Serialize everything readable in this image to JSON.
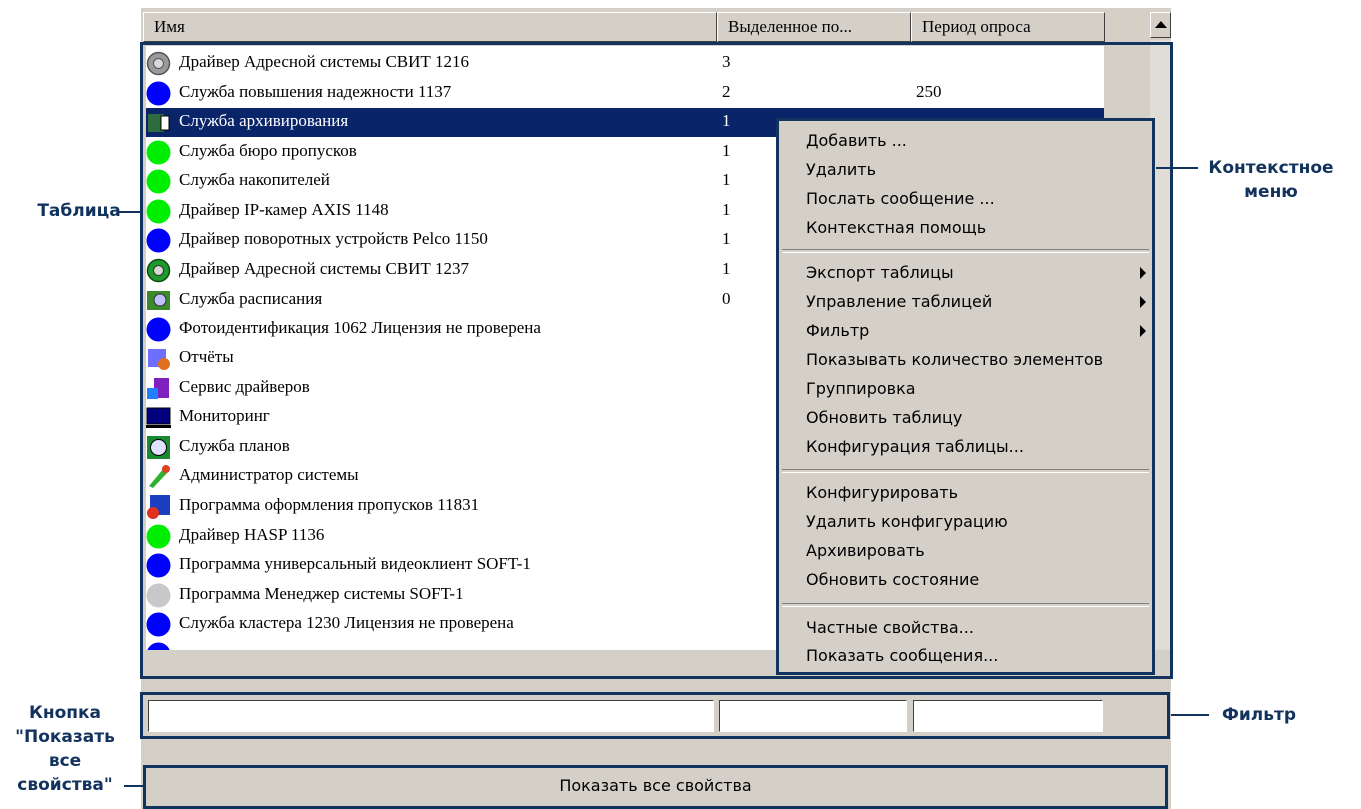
{
  "columns": [
    "Имя",
    "Выделенное по...",
    "Период опроса"
  ],
  "rows": [
    {
      "name": "Драйвер Адресной системы СВИТ 1216",
      "alloc": "3",
      "period": "",
      "icon": "gear-gray-icon"
    },
    {
      "name": "Служба повышения надежности 1137",
      "alloc": "2",
      "period": "250",
      "icon": "status-blue-icon"
    },
    {
      "name": "Служба архивирования",
      "alloc": "1",
      "period": "",
      "icon": "archive-icon"
    },
    {
      "name": "Служба бюро пропусков",
      "alloc": "1",
      "period": "",
      "icon": "status-green-icon"
    },
    {
      "name": "Служба накопителей",
      "alloc": "1",
      "period": "",
      "icon": "status-green-icon"
    },
    {
      "name": "Драйвер IP-камер AXIS 1148",
      "alloc": "1",
      "period": "",
      "icon": "status-green-icon"
    },
    {
      "name": "Драйвер поворотных устройств Pelco 1150",
      "alloc": "1",
      "period": "",
      "icon": "status-blue-icon"
    },
    {
      "name": "Драйвер Адресной системы СВИТ 1237",
      "alloc": "1",
      "period": "",
      "icon": "gear-green-icon"
    },
    {
      "name": "Служба расписания",
      "alloc": "0",
      "period": "",
      "icon": "schedule-icon"
    },
    {
      "name": "Фотоидентификация 1062 Лицензия не проверена",
      "alloc": "",
      "period": "",
      "icon": "status-blue-icon"
    },
    {
      "name": "Отчёты",
      "alloc": "",
      "period": "",
      "icon": "reports-icon"
    },
    {
      "name": "Сервис драйверов",
      "alloc": "",
      "period": "",
      "icon": "drivers-icon"
    },
    {
      "name": "Мониторинг",
      "alloc": "",
      "period": "",
      "icon": "monitor-icon"
    },
    {
      "name": "Служба планов",
      "alloc": "",
      "period": "",
      "icon": "plans-icon"
    },
    {
      "name": "Администратор системы",
      "alloc": "",
      "period": "",
      "icon": "admin-icon"
    },
    {
      "name": "Программа оформления пропусков 11831",
      "alloc": "",
      "period": "",
      "icon": "pass-program-icon"
    },
    {
      "name": "Драйвер HASP 1136",
      "alloc": "",
      "period": "",
      "icon": "status-green-icon"
    },
    {
      "name": "Программа универсальный видеоклиент SOFT-1",
      "alloc": "",
      "period": "",
      "icon": "status-blue-icon"
    },
    {
      "name": "Программа Менеджер системы SOFT-1",
      "alloc": "",
      "period": "",
      "icon": "status-gray-icon"
    },
    {
      "name": "Служба кластера 1230 Лицензия не проверена",
      "alloc": "",
      "period": "",
      "icon": "status-blue-icon"
    }
  ],
  "menu": {
    "add": "Добавить ...",
    "delete": "Удалить",
    "send": "Послать сообщение ...",
    "help": "Контекстная помощь",
    "export": "Экспорт таблицы",
    "manage": "Управление таблицей",
    "filter": "Фильтр",
    "count": "Показывать количество элементов",
    "group": "Группировка",
    "refresh": "Обновить таблицу",
    "config_table": "Конфигурация таблицы...",
    "configure": "Конфигурировать",
    "delete_config": "Удалить конфигурацию",
    "archive": "Архивировать",
    "refresh_state": "Обновить состояние",
    "private_props": "Частные свойства...",
    "show_messages": "Показать сообщения..."
  },
  "show_all_button": "Показать все свойства",
  "annotations": {
    "table": "Таблица",
    "context_menu_1": "Контекстное",
    "context_menu_2": "меню",
    "filter": "Фильтр",
    "button_1": "Кнопка",
    "button_2": "\"Показать",
    "button_3": "все",
    "button_4": "свойства\""
  },
  "colors": {
    "selection": "#0a246a",
    "annotation": "#12335e",
    "window": "#d4d0c8"
  }
}
